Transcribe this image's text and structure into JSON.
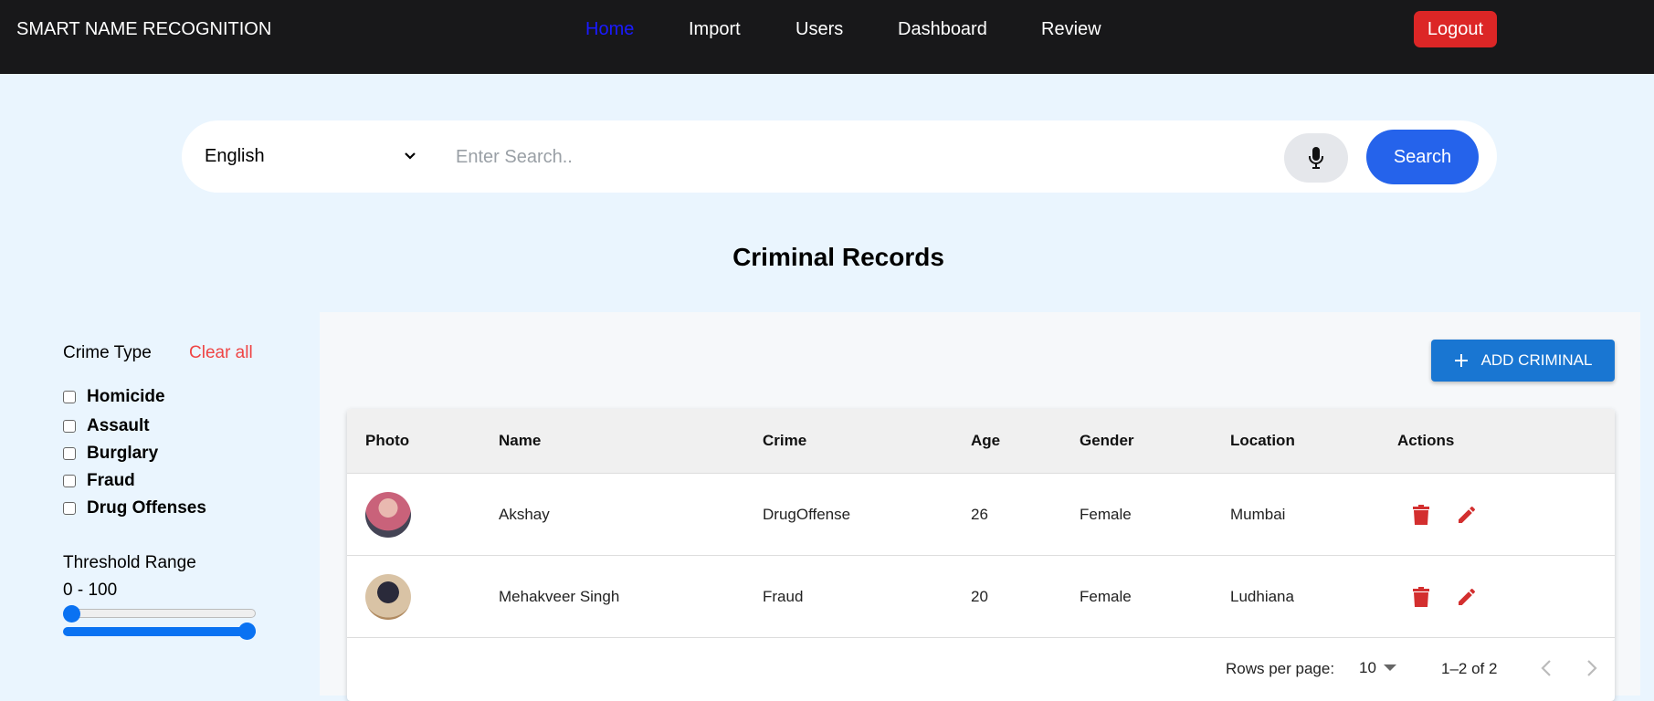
{
  "nav": {
    "brand": "SMART NAME RECOGNITION",
    "links": [
      "Home",
      "Import",
      "Users",
      "Dashboard",
      "Review"
    ],
    "active": "Home",
    "logout": "Logout"
  },
  "search": {
    "language": "English",
    "placeholder": "Enter Search..",
    "button": "Search"
  },
  "title": "Criminal Records",
  "filters": {
    "crime_type_label": "Crime Type",
    "clear_all": "Clear all",
    "crime_types": [
      "Homicide",
      "Assault",
      "Burglary",
      "Fraud",
      "Drug Offenses"
    ],
    "threshold_label": "Threshold Range",
    "threshold_value": "0 - 100",
    "threshold_min": 0,
    "threshold_max": 100
  },
  "add_button": "ADD CRIMINAL",
  "table": {
    "headers": [
      "Photo",
      "Name",
      "Crime",
      "Age",
      "Gender",
      "Location",
      "Actions"
    ],
    "rows": [
      {
        "name": "Akshay",
        "crime": "DrugOffense",
        "age": "26",
        "gender": "Female",
        "location": "Mumbai"
      },
      {
        "name": "Mehakveer Singh",
        "crime": "Fraud",
        "age": "20",
        "gender": "Female",
        "location": "Ludhiana"
      }
    ]
  },
  "pagination": {
    "rows_per_page_label": "Rows per page:",
    "rows_per_page": "10",
    "range": "1–2 of 2"
  },
  "colors": {
    "nav_bg": "#18181a",
    "accent": "#2563eb",
    "danger": "#dc2626",
    "action_icon": "#d32f2f"
  }
}
